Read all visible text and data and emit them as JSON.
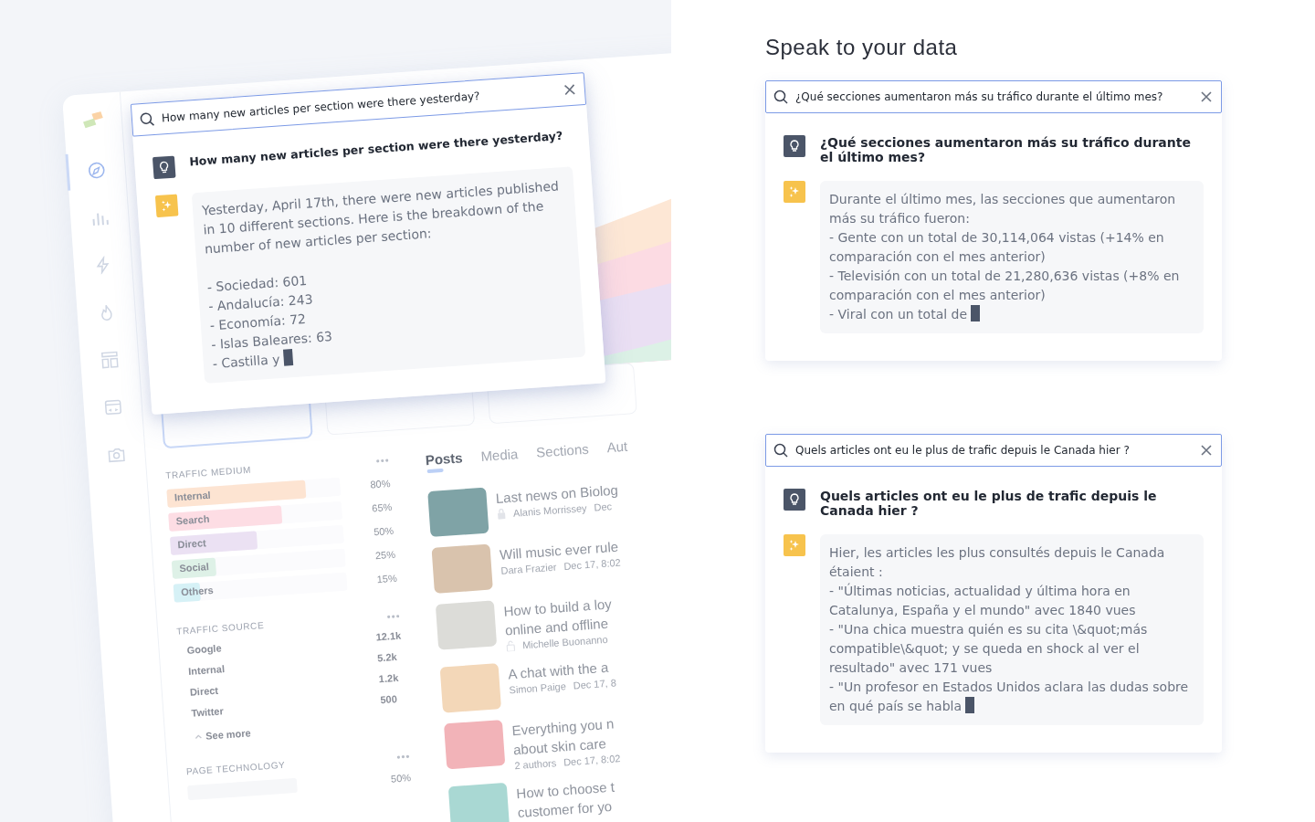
{
  "dashboard": {
    "sidebar": [
      {
        "selected": true
      },
      {
        "selected": false
      },
      {
        "selected": false
      },
      {
        "selected": false
      },
      {
        "selected": false
      },
      {
        "selected": false
      },
      {
        "selected": false
      }
    ],
    "chat": {
      "query": "How many new articles per section were there yesterday?",
      "question": "How many new articles per section were there yesterday?",
      "answer": "Yesterday, April 17th, there were new articles published in 10 different sections. Here is the breakdown of the number of new articles per section:\n\n- Sociedad: 601\n- Andalucía: 243\n- Economía: 72\n- Islas Baleares: 63\n- Castilla y"
    },
    "traffic_medium": {
      "title": "TRAFFIC MEDIUM",
      "bars": [
        {
          "label": "Internal",
          "level": 0.8,
          "reading": "80%",
          "color": "#fde4d2"
        },
        {
          "label": "Search",
          "level": 0.65,
          "reading": "65%",
          "color": "#fddde4"
        },
        {
          "label": "Direct",
          "level": 0.5,
          "reading": "50%",
          "color": "#ebe1f3"
        },
        {
          "label": "Social",
          "level": 0.25,
          "reading": "25%",
          "color": "#def1e7"
        },
        {
          "label": "Others",
          "level": 0.15,
          "reading": "15%",
          "color": "#d6f1f6"
        }
      ]
    },
    "traffic_source": {
      "title": "TRAFFIC SOURCE",
      "rows": [
        {
          "label": "Google",
          "value": "12.1k"
        },
        {
          "label": "Internal",
          "value": "5.2k"
        },
        {
          "label": "Direct",
          "value": "1.2k"
        },
        {
          "label": "Twitter",
          "value": "500"
        }
      ],
      "see_more": "See more"
    },
    "page_technology": {
      "title": "PAGE TECHNOLOGY",
      "reading": "50%"
    },
    "tabs": [
      {
        "label": "Posts",
        "selected": true
      },
      {
        "label": "Media",
        "selected": false
      },
      {
        "label": "Sections",
        "selected": false
      },
      {
        "label": "Aut",
        "selected": false
      }
    ],
    "posts": [
      {
        "title": [
          "Last news on Biolog"
        ],
        "author": "Alanis Morrissey",
        "date": "Dec",
        "locked": true,
        "color": "#7fa3a6"
      },
      {
        "title": [
          "Will music ever rule"
        ],
        "author": "Dara Frazier",
        "date": "Dec 17, 8:02",
        "color": "#d9c3ad"
      },
      {
        "title": [
          "How to build a loy",
          "online and offline"
        ],
        "author": "Michelle Buonanno",
        "locked": false,
        "color": "#dcdcd8"
      },
      {
        "title": [
          "A chat with the a"
        ],
        "author": "Simon Paige",
        "date": "Dec 17, 8",
        "color": "#f3d7b8"
      },
      {
        "title": [
          "Everything you n",
          "about skin care"
        ],
        "author": "2 authors",
        "date": "Dec 17, 8:02",
        "color": "#f2b3b8"
      },
      {
        "title": [
          "How to choose t",
          "customer for yo"
        ],
        "color": "#a9d8d3"
      }
    ]
  },
  "heading": "Speak to your data",
  "chats": [
    {
      "query": "¿Qué secciones aumentaron más su tráfico durante el último mes?",
      "question": "¿Qué secciones aumentaron más su tráfico durante el último mes?",
      "answer": "Durante el último mes, las secciones que aumentaron más su tráfico fueron:\n- Gente con un total de 30,114,064 vistas (+14% en comparación con el mes anterior)\n- Televisión con un total de 21,280,636 vistas (+8% en comparación con el mes anterior)\n- Viral con un total de"
    },
    {
      "query": "Quels articles ont eu le plus de trafic depuis le Canada hier ?",
      "question": "Quels articles ont eu le plus de trafic depuis le Canada hier ?",
      "answer": "Hier, les articles les plus consultés depuis le Canada étaient :\n- \"Últimas noticias, actualidad y última hora en Catalunya, España y el mundo\" avec 1840 vues\n- \"Una chica muestra quién es su cita \\&quot;más compatible\\&quot; y se queda en shock al ver el resultado\" avec 171 vues\n- \"Un profesor en Estados Unidos aclara las dudas sobre en qué país se habla"
    }
  ]
}
